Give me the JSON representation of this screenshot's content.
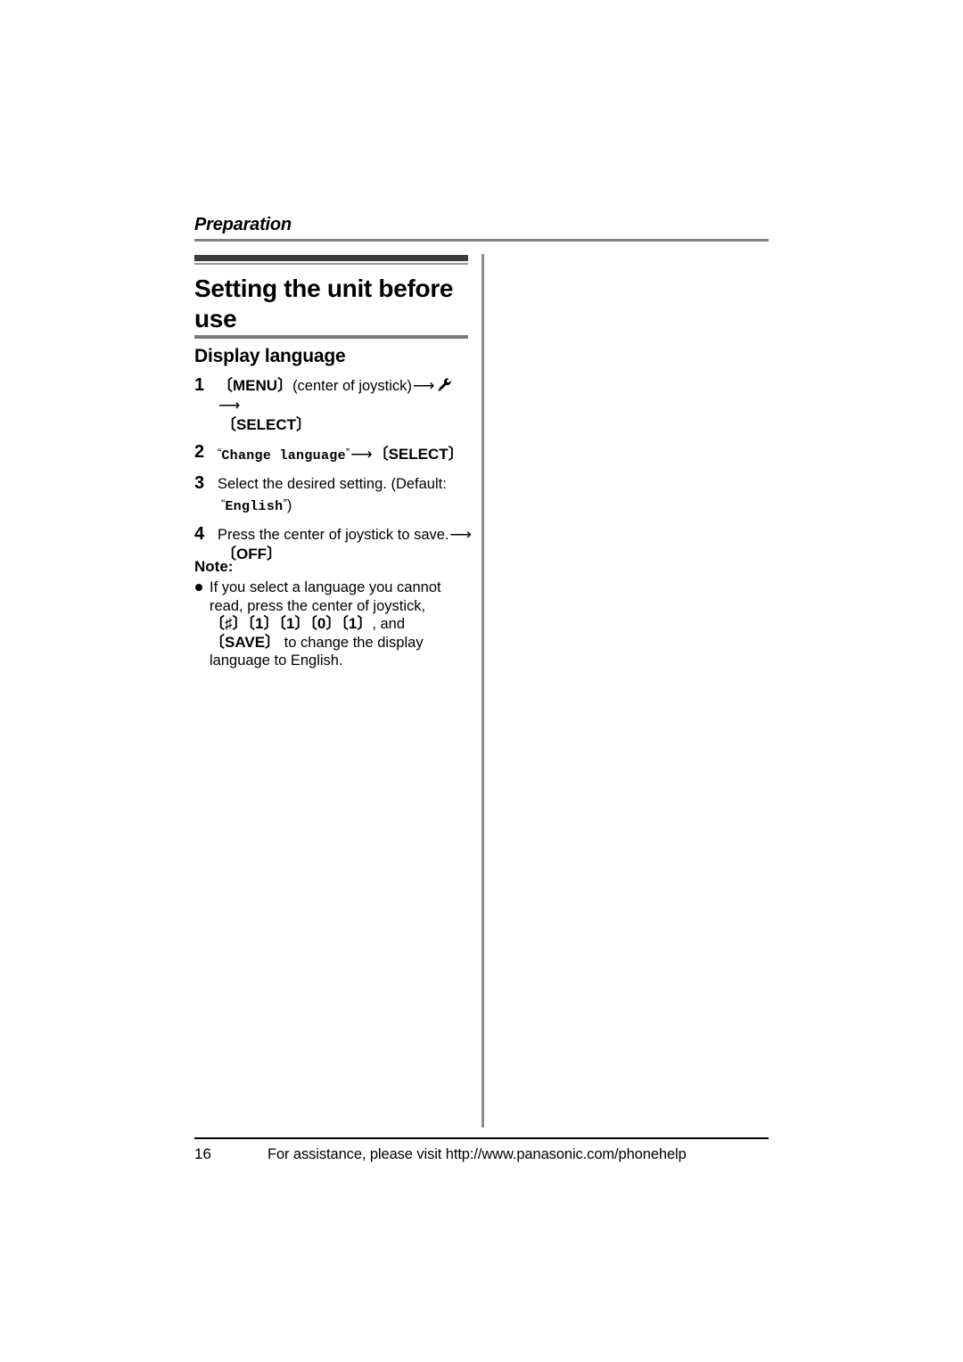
{
  "running_head": {
    "label": "Preparation"
  },
  "title": {
    "text": "Setting the unit before use"
  },
  "subheading": {
    "text": "Display language"
  },
  "steps": [
    {
      "number": "1",
      "line1_key1": "〔MENU〕",
      "line1_paren": "(center of joystick)",
      "line1_arrow1": "⟶",
      "line1_icon": "wrench-icon",
      "line1_arrow2": "⟶",
      "line2_key": "〔SELECT〕"
    },
    {
      "number": "2",
      "open_quote": "“",
      "mono_text": "Change language",
      "close_quote": "”",
      "arrow": "⟶",
      "key": "〔SELECT〕"
    },
    {
      "number": "3",
      "line1": "Select the desired setting. (Default:",
      "open_quote": "“",
      "mono_text": "English",
      "close_quote": "”",
      "close_paren": ")"
    },
    {
      "number": "4",
      "line1": "Press the center of joystick to save.",
      "arrow": "⟶",
      "line2_key": "〔OFF〕"
    }
  ],
  "note": {
    "title": "Note:",
    "item_part1": "If you select a language you cannot read, press the center of joystick,",
    "item_keys": "〔♯〕〔1〕〔1〕〔0〕〔1〕",
    "item_part2": ", and ",
    "item_key_save": "〔SAVE〕",
    "item_part3": " to change the display language to English."
  },
  "footer": {
    "page_number": "16",
    "assistance_text": "For assistance, please visit http://www.panasonic.com/phonehelp"
  },
  "colors": {
    "text": "#000000",
    "rule_gray": "#808080",
    "rule_dark": "#3c3c3c",
    "background": "#ffffff"
  }
}
